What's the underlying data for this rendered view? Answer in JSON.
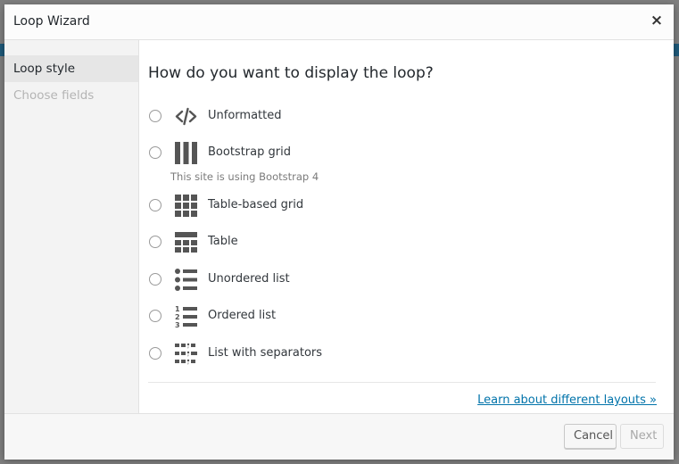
{
  "dialog": {
    "title": "Loop Wizard",
    "close_symbol": "×"
  },
  "sidebar": {
    "items": [
      {
        "label": "Loop style",
        "state": "active"
      },
      {
        "label": "Choose fields",
        "state": "disabled"
      }
    ]
  },
  "main": {
    "question": "How do you want to display the loop?",
    "options": [
      {
        "label": "Unformatted",
        "icon": "code-icon"
      },
      {
        "label": "Bootstrap grid",
        "icon": "columns-icon",
        "note": "This site is using Bootstrap 4"
      },
      {
        "label": "Table-based grid",
        "icon": "grid-icon"
      },
      {
        "label": "Table",
        "icon": "table-icon"
      },
      {
        "label": "Unordered list",
        "icon": "bulleted-list-icon"
      },
      {
        "label": "Ordered list",
        "icon": "numbered-list-icon"
      },
      {
        "label": "List with separators",
        "icon": "separated-list-icon"
      }
    ],
    "learn_link": "Learn about different layouts »"
  },
  "footer": {
    "cancel_label": "Cancel",
    "next_label": "Next"
  },
  "colors": {
    "accent_link": "#0073aa",
    "icon_gray": "#555555"
  }
}
